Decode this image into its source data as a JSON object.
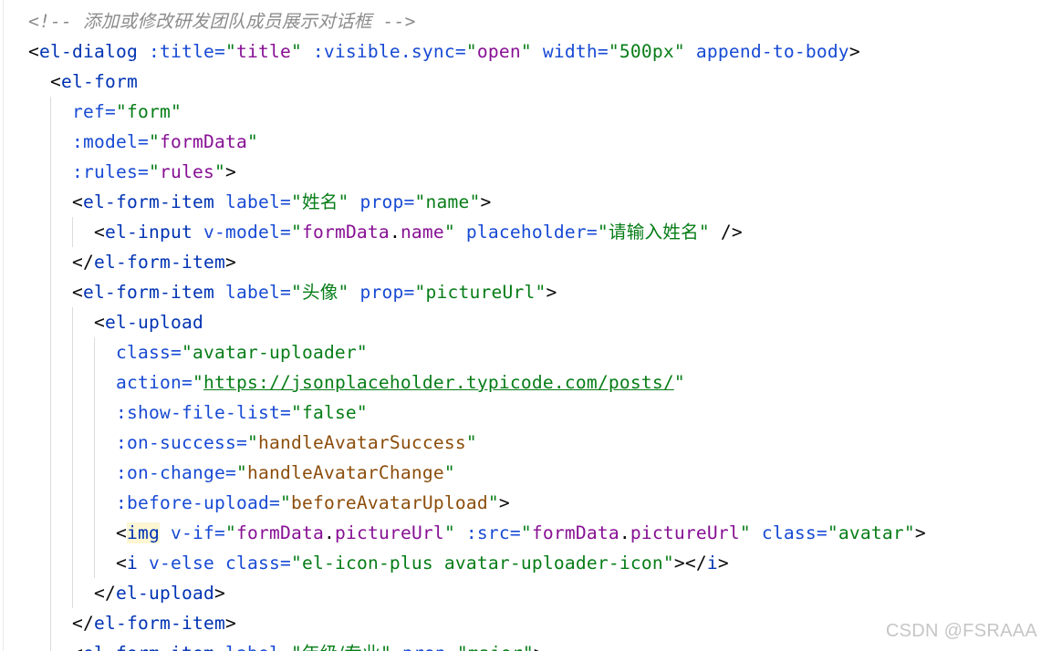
{
  "lines": [
    {
      "tokens": [
        {
          "t": "<!-- ",
          "c": "t-cmt"
        },
        {
          "t": "添加或修改研发团队成员展示对话框",
          "c": "t-cmt cjk"
        },
        {
          "t": " -->",
          "c": "t-cmt"
        }
      ]
    },
    {
      "tokens": [
        {
          "t": "<",
          "c": "t-p"
        },
        {
          "t": "el-dialog",
          "c": "t-tag"
        },
        {
          "t": " :title=",
          "c": "t-attr"
        },
        {
          "t": "\"",
          "c": "t-str"
        },
        {
          "t": "title",
          "c": "t-mag"
        },
        {
          "t": "\"",
          "c": "t-str"
        },
        {
          "t": " :visible.sync=",
          "c": "t-attr"
        },
        {
          "t": "\"",
          "c": "t-str"
        },
        {
          "t": "open",
          "c": "t-mag"
        },
        {
          "t": "\"",
          "c": "t-str"
        },
        {
          "t": " width=",
          "c": "t-attr"
        },
        {
          "t": "\"500px\"",
          "c": "t-str"
        },
        {
          "t": " append-to-body",
          "c": "t-attr"
        },
        {
          "t": ">",
          "c": "t-p"
        }
      ]
    },
    {
      "tokens": [
        {
          "t": "<",
          "c": "t-p"
        },
        {
          "t": "el-form",
          "c": "t-tag"
        }
      ]
    },
    {
      "tokens": [
        {
          "t": "ref=",
          "c": "t-attr"
        },
        {
          "t": "\"form\"",
          "c": "t-str"
        }
      ]
    },
    {
      "tokens": [
        {
          "t": ":model=",
          "c": "t-attr"
        },
        {
          "t": "\"",
          "c": "t-str"
        },
        {
          "t": "formData",
          "c": "t-mag"
        },
        {
          "t": "\"",
          "c": "t-str"
        }
      ]
    },
    {
      "tokens": [
        {
          "t": ":rules=",
          "c": "t-attr"
        },
        {
          "t": "\"",
          "c": "t-str"
        },
        {
          "t": "rules",
          "c": "t-mag"
        },
        {
          "t": "\"",
          "c": "t-str"
        },
        {
          "t": ">",
          "c": "t-p"
        }
      ]
    },
    {
      "tokens": [
        {
          "t": "<",
          "c": "t-p"
        },
        {
          "t": "el-form-item",
          "c": "t-tag"
        },
        {
          "t": " label=",
          "c": "t-attr"
        },
        {
          "t": "\"",
          "c": "t-str"
        },
        {
          "t": "姓名",
          "c": "t-str cjk"
        },
        {
          "t": "\"",
          "c": "t-str"
        },
        {
          "t": " prop=",
          "c": "t-attr"
        },
        {
          "t": "\"name\"",
          "c": "t-str"
        },
        {
          "t": ">",
          "c": "t-p"
        }
      ]
    },
    {
      "tokens": [
        {
          "t": "<",
          "c": "t-p"
        },
        {
          "t": "el-input",
          "c": "t-tag"
        },
        {
          "t": " v-model=",
          "c": "t-attr"
        },
        {
          "t": "\"",
          "c": "t-str"
        },
        {
          "t": "formData",
          "c": "t-mag"
        },
        {
          "t": ".",
          "c": "t-p"
        },
        {
          "t": "name",
          "c": "t-mag"
        },
        {
          "t": "\"",
          "c": "t-str"
        },
        {
          "t": " placeholder=",
          "c": "t-attr"
        },
        {
          "t": "\"",
          "c": "t-str"
        },
        {
          "t": "请输入姓名",
          "c": "t-str cjk"
        },
        {
          "t": "\"",
          "c": "t-str"
        },
        {
          "t": " />",
          "c": "t-p"
        }
      ]
    },
    {
      "tokens": [
        {
          "t": "</",
          "c": "t-p"
        },
        {
          "t": "el-form-item",
          "c": "t-tag"
        },
        {
          "t": ">",
          "c": "t-p"
        }
      ]
    },
    {
      "tokens": [
        {
          "t": "<",
          "c": "t-p"
        },
        {
          "t": "el-form-item",
          "c": "t-tag"
        },
        {
          "t": " label=",
          "c": "t-attr"
        },
        {
          "t": "\"",
          "c": "t-str"
        },
        {
          "t": "头像",
          "c": "t-str cjk"
        },
        {
          "t": "\"",
          "c": "t-str"
        },
        {
          "t": " prop=",
          "c": "t-attr"
        },
        {
          "t": "\"pictureUrl\"",
          "c": "t-str"
        },
        {
          "t": ">",
          "c": "t-p"
        }
      ]
    },
    {
      "tokens": [
        {
          "t": "<",
          "c": "t-p"
        },
        {
          "t": "el-upload",
          "c": "t-tag"
        }
      ]
    },
    {
      "tokens": [
        {
          "t": "class=",
          "c": "t-attr"
        },
        {
          "t": "\"avatar-uploader\"",
          "c": "t-str"
        }
      ]
    },
    {
      "tokens": [
        {
          "t": "action=",
          "c": "t-attr"
        },
        {
          "t": "\"",
          "c": "t-str"
        },
        {
          "t": "https://jsonplaceholder.typicode.com/posts/",
          "c": "t-url"
        },
        {
          "t": "\"",
          "c": "t-str"
        }
      ]
    },
    {
      "tokens": [
        {
          "t": ":show-file-list=",
          "c": "t-attr"
        },
        {
          "t": "\"false\"",
          "c": "t-str"
        }
      ]
    },
    {
      "tokens": [
        {
          "t": ":on-success=",
          "c": "t-attr"
        },
        {
          "t": "\"",
          "c": "t-str"
        },
        {
          "t": "handleAvatarSuccess",
          "c": "t-fn"
        },
        {
          "t": "\"",
          "c": "t-str"
        }
      ]
    },
    {
      "tokens": [
        {
          "t": ":on-change=",
          "c": "t-attr"
        },
        {
          "t": "\"",
          "c": "t-str"
        },
        {
          "t": "handleAvatarChange",
          "c": "t-fn"
        },
        {
          "t": "\"",
          "c": "t-str"
        }
      ]
    },
    {
      "tokens": [
        {
          "t": ":before-upload=",
          "c": "t-attr"
        },
        {
          "t": "\"",
          "c": "t-str"
        },
        {
          "t": "beforeAvatarUpload",
          "c": "t-fn"
        },
        {
          "t": "\"",
          "c": "t-str"
        },
        {
          "t": ">",
          "c": "t-p"
        }
      ]
    },
    {
      "tokens": [
        {
          "t": "<",
          "c": "t-p"
        },
        {
          "t": "img",
          "c": "t-hl"
        },
        {
          "t": " v-if=",
          "c": "t-attr"
        },
        {
          "t": "\"",
          "c": "t-str"
        },
        {
          "t": "formData",
          "c": "t-mag"
        },
        {
          "t": ".",
          "c": "t-p"
        },
        {
          "t": "pictureUrl",
          "c": "t-mag"
        },
        {
          "t": "\"",
          "c": "t-str"
        },
        {
          "t": " :src=",
          "c": "t-attr"
        },
        {
          "t": "\"",
          "c": "t-str"
        },
        {
          "t": "formData",
          "c": "t-mag"
        },
        {
          "t": ".",
          "c": "t-p"
        },
        {
          "t": "pictureUrl",
          "c": "t-mag"
        },
        {
          "t": "\"",
          "c": "t-str"
        },
        {
          "t": " class=",
          "c": "t-attr"
        },
        {
          "t": "\"avatar\"",
          "c": "t-str"
        },
        {
          "t": ">",
          "c": "t-p"
        }
      ]
    },
    {
      "tokens": [
        {
          "t": "<",
          "c": "t-p"
        },
        {
          "t": "i",
          "c": "t-tag"
        },
        {
          "t": " v-else",
          "c": "t-attr"
        },
        {
          "t": " class=",
          "c": "t-attr"
        },
        {
          "t": "\"el-icon-plus avatar-uploader-icon\"",
          "c": "t-str"
        },
        {
          "t": "></",
          "c": "t-p"
        },
        {
          "t": "i",
          "c": "t-tag"
        },
        {
          "t": ">",
          "c": "t-p"
        }
      ]
    },
    {
      "tokens": [
        {
          "t": "</",
          "c": "t-p"
        },
        {
          "t": "el-upload",
          "c": "t-tag"
        },
        {
          "t": ">",
          "c": "t-p"
        }
      ]
    },
    {
      "tokens": [
        {
          "t": "</",
          "c": "t-p"
        },
        {
          "t": "el-form-item",
          "c": "t-tag"
        },
        {
          "t": ">",
          "c": "t-p"
        }
      ]
    },
    {
      "tokens": [
        {
          "t": "<",
          "c": "t-p"
        },
        {
          "t": "el-form-item",
          "c": "t-tag"
        },
        {
          "t": " label=",
          "c": "t-attr"
        },
        {
          "t": "\"",
          "c": "t-str"
        },
        {
          "t": "年级/专业",
          "c": "t-str cjk"
        },
        {
          "t": "\"",
          "c": "t-str"
        },
        {
          "t": " prop=",
          "c": "t-attr"
        },
        {
          "t": "\"major\"",
          "c": "t-str"
        },
        {
          "t": ">",
          "c": "t-p"
        }
      ]
    }
  ],
  "watermark": "CSDN @FSRAAA"
}
